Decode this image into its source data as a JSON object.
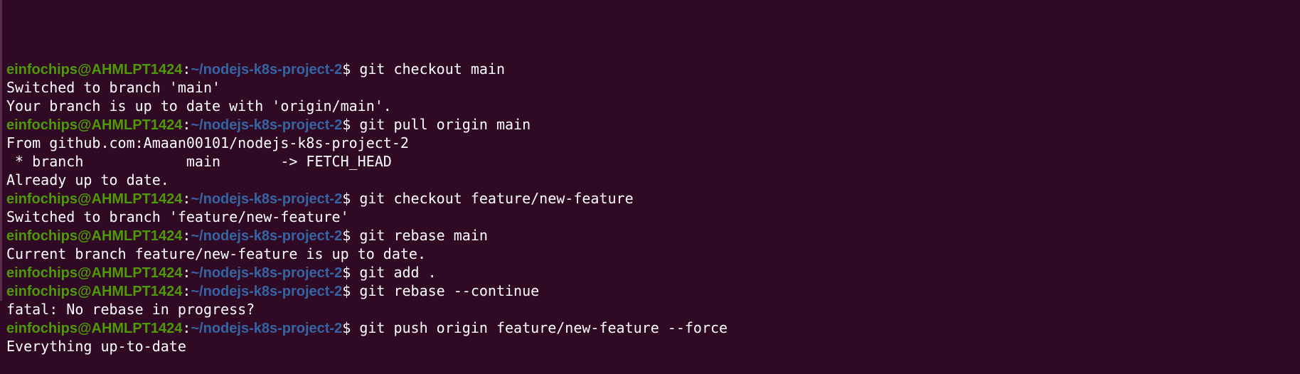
{
  "terminal": {
    "prompt_user": "einfochips@AHMLPT1424",
    "prompt_colon": ":",
    "prompt_path": "~/nodejs-k8s-project-2",
    "prompt_symbol": "$ ",
    "lines": [
      {
        "type": "cmd",
        "text": "git checkout main"
      },
      {
        "type": "out",
        "text": "Switched to branch 'main'"
      },
      {
        "type": "out",
        "text": "Your branch is up to date with 'origin/main'."
      },
      {
        "type": "cmd",
        "text": "git pull origin main"
      },
      {
        "type": "out",
        "text": "From github.com:Amaan00101/nodejs-k8s-project-2"
      },
      {
        "type": "out",
        "text": " * branch            main       -> FETCH_HEAD"
      },
      {
        "type": "out",
        "text": "Already up to date."
      },
      {
        "type": "cmd",
        "text": "git checkout feature/new-feature"
      },
      {
        "type": "out",
        "text": "Switched to branch 'feature/new-feature'"
      },
      {
        "type": "cmd",
        "text": "git rebase main"
      },
      {
        "type": "out",
        "text": "Current branch feature/new-feature is up to date."
      },
      {
        "type": "cmd",
        "text": "git add ."
      },
      {
        "type": "cmd",
        "text": "git rebase --continue"
      },
      {
        "type": "out",
        "text": "fatal: No rebase in progress?"
      },
      {
        "type": "cmd",
        "text": "git push origin feature/new-feature --force"
      },
      {
        "type": "out",
        "text": "Everything up-to-date"
      }
    ]
  },
  "colors": {
    "background": "#300a24",
    "prompt_user": "#4e9a06",
    "prompt_path": "#3465a4",
    "text": "#ffffff"
  }
}
